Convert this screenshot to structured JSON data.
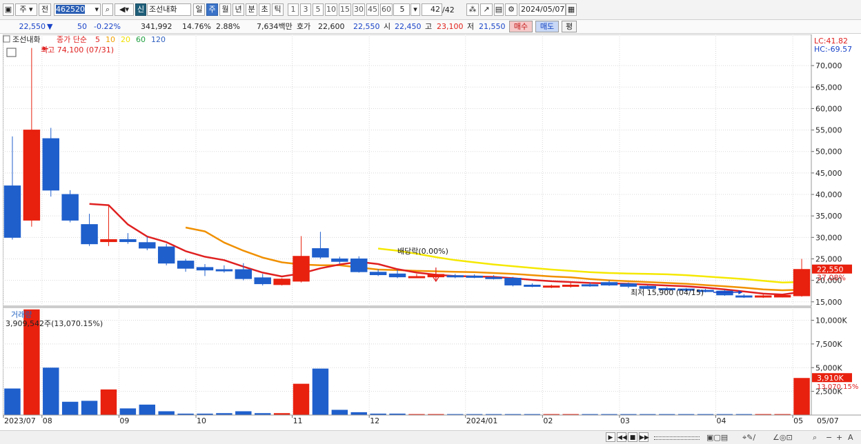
{
  "toolbar": {
    "market_label": "주",
    "prev_label": "전",
    "code_value": "462520",
    "stock_badge": "신",
    "stock_name": "조선내화",
    "periods": [
      "일",
      "주",
      "월",
      "년",
      "분",
      "초",
      "틱"
    ],
    "active_period": "주",
    "period_numbers": [
      "1",
      "3",
      "5",
      "10",
      "15",
      "30",
      "45",
      "60"
    ],
    "count_value": "5",
    "page_value": "42",
    "page_total": "/42",
    "date_value": "2024/05/07"
  },
  "infobar": {
    "price": "22,550",
    "change_arrow": "▼",
    "change": "50",
    "change_pct": "-0.22%",
    "volume": "341,992",
    "turnover": "14.76%",
    "ratio": "2.88%",
    "amount": "7,634백만",
    "quote_label": "호가",
    "quote_value": "22,600",
    "quote_value2": "22,550",
    "open_label": "시",
    "open_value": "22,450",
    "high_label": "고",
    "high_value": "23,100",
    "low_label": "저",
    "low_value": "21,550",
    "buy_label": "매수",
    "sell_label": "매도",
    "avg_label": "평"
  },
  "price_panel": {
    "stock_tag": "조선내화",
    "legend_prefix": "종가 단순",
    "legend_items": [
      {
        "label": "5",
        "color": "#e02020"
      },
      {
        "label": "10",
        "color": "#f0a000"
      },
      {
        "label": "20",
        "color": "#f0e000"
      },
      {
        "label": "60",
        "color": "#20a040"
      },
      {
        "label": "120",
        "color": "#3060c0"
      }
    ],
    "high_annotation": "최고 74,100 (07/31)",
    "low_annotation": "최저 15,900 (04/15)",
    "dividend_annotation": "배당락(0.00%)",
    "lc": "LC:41.82",
    "hc": "HC:-69.57",
    "current_price_tag": "22,550",
    "current_pct_tag": "37.08%",
    "price_ticks": [
      "70,000",
      "65,000",
      "60,000",
      "55,000",
      "50,000",
      "45,000",
      "40,000",
      "35,000",
      "30,000",
      "25,000",
      "20,000",
      "15,000"
    ]
  },
  "volume_panel": {
    "title": "거래량",
    "info": "3,909,542주(13,070.15%)",
    "volume_ticks": [
      "10,000K",
      "7,500K",
      "5,000K",
      "2,500K"
    ],
    "current_tag": "3,910K",
    "current_pct": "13,070.15%"
  },
  "x_axis": {
    "labels": [
      "2023/07",
      "08",
      "09",
      "10",
      "11",
      "12",
      "2024/01",
      "02",
      "03",
      "04",
      "05"
    ],
    "end_label": "05/07"
  },
  "colors": {
    "up": "#e8200e",
    "down": "#1f5fcc",
    "ma5": "#e02020",
    "ma10": "#f09000",
    "ma20": "#f5e800",
    "volume_up": "#e8200e",
    "volume_down": "#1f5fcc"
  },
  "chart_data": {
    "type": "candlestick",
    "unit": "KRW",
    "ylim": [
      14000,
      75000
    ],
    "candles": [
      {
        "o": 42000,
        "c": 30000,
        "h": 53500,
        "l": 29500
      },
      {
        "o": 34000,
        "c": 55000,
        "h": 74100,
        "l": 32500
      },
      {
        "o": 53000,
        "c": 41000,
        "h": 55500,
        "l": 39500
      },
      {
        "o": 40000,
        "c": 34000,
        "h": 41000,
        "l": 33500
      },
      {
        "o": 33000,
        "c": 28500,
        "h": 35500,
        "l": 28000
      },
      {
        "o": 29000,
        "c": 29500,
        "h": 37500,
        "l": 28000
      },
      {
        "o": 29500,
        "c": 29000,
        "h": 31000,
        "l": 28500
      },
      {
        "o": 28800,
        "c": 27500,
        "h": 30200,
        "l": 27000
      },
      {
        "o": 27800,
        "c": 24000,
        "h": 28500,
        "l": 23500
      },
      {
        "o": 24500,
        "c": 22800,
        "h": 25000,
        "l": 22000
      },
      {
        "o": 23000,
        "c": 22400,
        "h": 23800,
        "l": 21000
      },
      {
        "o": 22500,
        "c": 22200,
        "h": 23500,
        "l": 21800
      },
      {
        "o": 22500,
        "c": 20400,
        "h": 24000,
        "l": 20000
      },
      {
        "o": 20600,
        "c": 19200,
        "h": 21500,
        "l": 18800
      },
      {
        "o": 19000,
        "c": 20300,
        "h": 20500,
        "l": 18800
      },
      {
        "o": 19800,
        "c": 25600,
        "h": 30300,
        "l": 19500
      },
      {
        "o": 27400,
        "c": 25400,
        "h": 31300,
        "l": 25000
      },
      {
        "o": 25000,
        "c": 24400,
        "h": 25500,
        "l": 23800
      },
      {
        "o": 25000,
        "c": 22000,
        "h": 25600,
        "l": 21800
      },
      {
        "o": 21900,
        "c": 21300,
        "h": 22600,
        "l": 21000
      },
      {
        "o": 21500,
        "c": 20800,
        "h": 22500,
        "l": 20500
      },
      {
        "o": 20800,
        "c": 20900,
        "h": 21500,
        "l": 20500
      },
      {
        "o": 20800,
        "c": 21400,
        "h": 21800,
        "l": 20500
      },
      {
        "o": 21100,
        "c": 20800,
        "h": 21500,
        "l": 20500
      },
      {
        "o": 21000,
        "c": 20700,
        "h": 21400,
        "l": 20500
      },
      {
        "o": 20700,
        "c": 20500,
        "h": 21200,
        "l": 20200
      },
      {
        "o": 20500,
        "c": 18900,
        "h": 20800,
        "l": 18600
      },
      {
        "o": 18900,
        "c": 18700,
        "h": 19300,
        "l": 18400
      },
      {
        "o": 18500,
        "c": 18700,
        "h": 19000,
        "l": 18200
      },
      {
        "o": 18600,
        "c": 18900,
        "h": 19400,
        "l": 18300
      },
      {
        "o": 19000,
        "c": 18800,
        "h": 19500,
        "l": 18500
      },
      {
        "o": 19500,
        "c": 18900,
        "h": 20000,
        "l": 18700
      },
      {
        "o": 19200,
        "c": 18600,
        "h": 19500,
        "l": 18200
      },
      {
        "o": 18600,
        "c": 18100,
        "h": 18900,
        "l": 17900
      },
      {
        "o": 18100,
        "c": 18000,
        "h": 18400,
        "l": 17800
      },
      {
        "o": 18000,
        "c": 17700,
        "h": 18200,
        "l": 17400
      },
      {
        "o": 17700,
        "c": 17400,
        "h": 18000,
        "l": 17200
      },
      {
        "o": 17500,
        "c": 16600,
        "h": 17800,
        "l": 16400
      },
      {
        "o": 16400,
        "c": 16200,
        "h": 16800,
        "l": 15900
      },
      {
        "o": 16100,
        "c": 16400,
        "h": 16700,
        "l": 15900
      },
      {
        "o": 16100,
        "c": 16500,
        "h": 16800,
        "l": 16000
      },
      {
        "o": 16400,
        "c": 22550,
        "h": 25000,
        "l": 16200
      }
    ],
    "ma5": [
      null,
      null,
      null,
      null,
      37800,
      37500,
      33000,
      30200,
      28900,
      26800,
      25500,
      24700,
      23200,
      21800,
      20900,
      21600,
      22800,
      23700,
      24300,
      23800,
      22600,
      21800,
      21300,
      21000,
      20900,
      20800,
      20500,
      20100,
      19800,
      19600,
      19400,
      19300,
      19200,
      19000,
      18800,
      18600,
      18300,
      17900,
      17400,
      16900,
      16700,
      17300
    ],
    "ma10": [
      null,
      null,
      null,
      null,
      null,
      null,
      null,
      null,
      null,
      32300,
      31400,
      28800,
      26900,
      25300,
      24200,
      23700,
      23500,
      23500,
      23000,
      22500,
      22400,
      22200,
      22100,
      22000,
      21900,
      21700,
      21500,
      21200,
      20900,
      20700,
      20300,
      20000,
      19800,
      19600,
      19400,
      19200,
      18900,
      18600,
      18300,
      17900,
      17700,
      17800
    ],
    "ma20": [
      null,
      null,
      null,
      null,
      null,
      null,
      null,
      null,
      null,
      null,
      null,
      null,
      null,
      null,
      null,
      null,
      null,
      null,
      null,
      27400,
      26900,
      26200,
      25400,
      24700,
      24200,
      23700,
      23300,
      22900,
      22500,
      22200,
      21900,
      21700,
      21600,
      21500,
      21400,
      21200,
      20900,
      20600,
      20300,
      19900,
      19500,
      19600
    ],
    "volumes": [
      2800,
      12600,
      5000,
      1400,
      1500,
      2700,
      700,
      1100,
      400,
      150,
      150,
      200,
      400,
      200,
      200,
      3300,
      4900,
      550,
      300,
      150,
      150,
      100,
      100,
      100,
      100,
      100,
      100,
      100,
      100,
      100,
      100,
      100,
      100,
      100,
      100,
      100,
      100,
      100,
      100,
      100,
      100,
      3910
    ],
    "volume_ylim": [
      0,
      11200
    ],
    "x_tick_indices": [
      0,
      2,
      6,
      10,
      15,
      19,
      24,
      28,
      32,
      37,
      41
    ]
  }
}
